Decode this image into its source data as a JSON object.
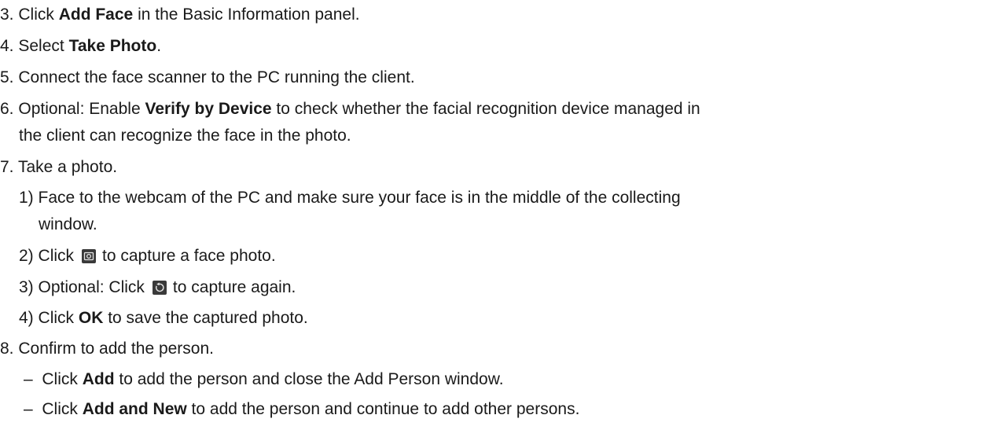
{
  "steps": {
    "s3": {
      "num": "3.",
      "pre": "Click ",
      "bold": "Add Face",
      "post": " in the Basic Information panel."
    },
    "s4": {
      "num": "4.",
      "pre": "Select ",
      "bold": "Take Photo",
      "post": "."
    },
    "s5": {
      "num": "5.",
      "text": "Connect the face scanner to the PC running the client."
    },
    "s6": {
      "num": "6.",
      "pre": "Optional: Enable ",
      "bold": "Verify by Device",
      "post": " to check whether the facial recognition device managed in",
      "cont": "the client can recognize the face in the photo."
    },
    "s7": {
      "num": "7.",
      "text": "Take a photo.",
      "sub": {
        "a": {
          "num": "1)",
          "text": "Face to the webcam of the PC and make sure your face is in the middle of the collecting",
          "cont": "window."
        },
        "b": {
          "num": "2)",
          "pre": "Click",
          "post": "to capture a face photo."
        },
        "c": {
          "num": "3)",
          "pre": "Optional: Click",
          "post": "to capture again."
        },
        "d": {
          "num": "4)",
          "pre": "Click ",
          "bold": "OK",
          "post": " to save the captured photo."
        }
      }
    },
    "s8": {
      "num": "8.",
      "text": "Confirm to add the person.",
      "bullets": {
        "a": {
          "dash": "–",
          "pre": "Click ",
          "bold": "Add",
          "post": " to add the person and close the Add Person window."
        },
        "b": {
          "dash": "–",
          "pre": "Click ",
          "bold": "Add and New",
          "post": " to add the person and continue to add other persons."
        }
      }
    }
  },
  "icons": {
    "camera": "camera-icon",
    "refresh": "refresh-icon"
  }
}
